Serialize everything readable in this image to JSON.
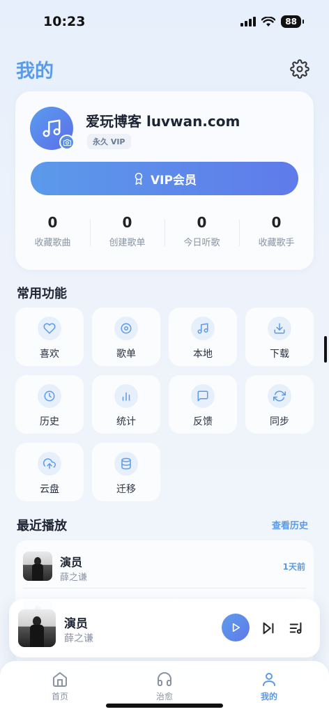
{
  "status_bar": {
    "time": "10:23",
    "battery": "88"
  },
  "header": {
    "title": "我的"
  },
  "profile": {
    "name": "爱玩博客 luvwan.com",
    "badge": "永久 VIP",
    "vip_button_label": "VIP会员",
    "stats": [
      {
        "value": "0",
        "label": "收藏歌曲"
      },
      {
        "value": "0",
        "label": "创建歌单"
      },
      {
        "value": "0",
        "label": "今日听歌"
      },
      {
        "value": "0",
        "label": "收藏歌手"
      }
    ]
  },
  "functions": {
    "title": "常用功能",
    "items": [
      {
        "label": "喜欢",
        "icon": "heart-icon"
      },
      {
        "label": "歌单",
        "icon": "disc-icon"
      },
      {
        "label": "本地",
        "icon": "music-note-icon"
      },
      {
        "label": "下载",
        "icon": "download-icon"
      },
      {
        "label": "历史",
        "icon": "clock-icon"
      },
      {
        "label": "统计",
        "icon": "bar-chart-icon"
      },
      {
        "label": "反馈",
        "icon": "message-icon"
      },
      {
        "label": "同步",
        "icon": "sync-icon"
      },
      {
        "label": "云盘",
        "icon": "cloud-upload-icon"
      },
      {
        "label": "迁移",
        "icon": "database-icon"
      }
    ]
  },
  "recent": {
    "title": "最近播放",
    "history_link": "查看历史",
    "items": [
      {
        "title": "演员",
        "artist": "薛之谦",
        "time": "1天前"
      }
    ]
  },
  "now_playing": {
    "title": "演员",
    "artist": "薛之谦"
  },
  "tabs": [
    {
      "label": "首页",
      "icon": "home-icon",
      "active": false
    },
    {
      "label": "治愈",
      "icon": "headphones-icon",
      "active": false
    },
    {
      "label": "我的",
      "icon": "user-icon",
      "active": true
    }
  ],
  "colors": {
    "accent": "#5b9ae8",
    "gradient_start": "#5b9aea",
    "gradient_end": "#5f7bea"
  }
}
